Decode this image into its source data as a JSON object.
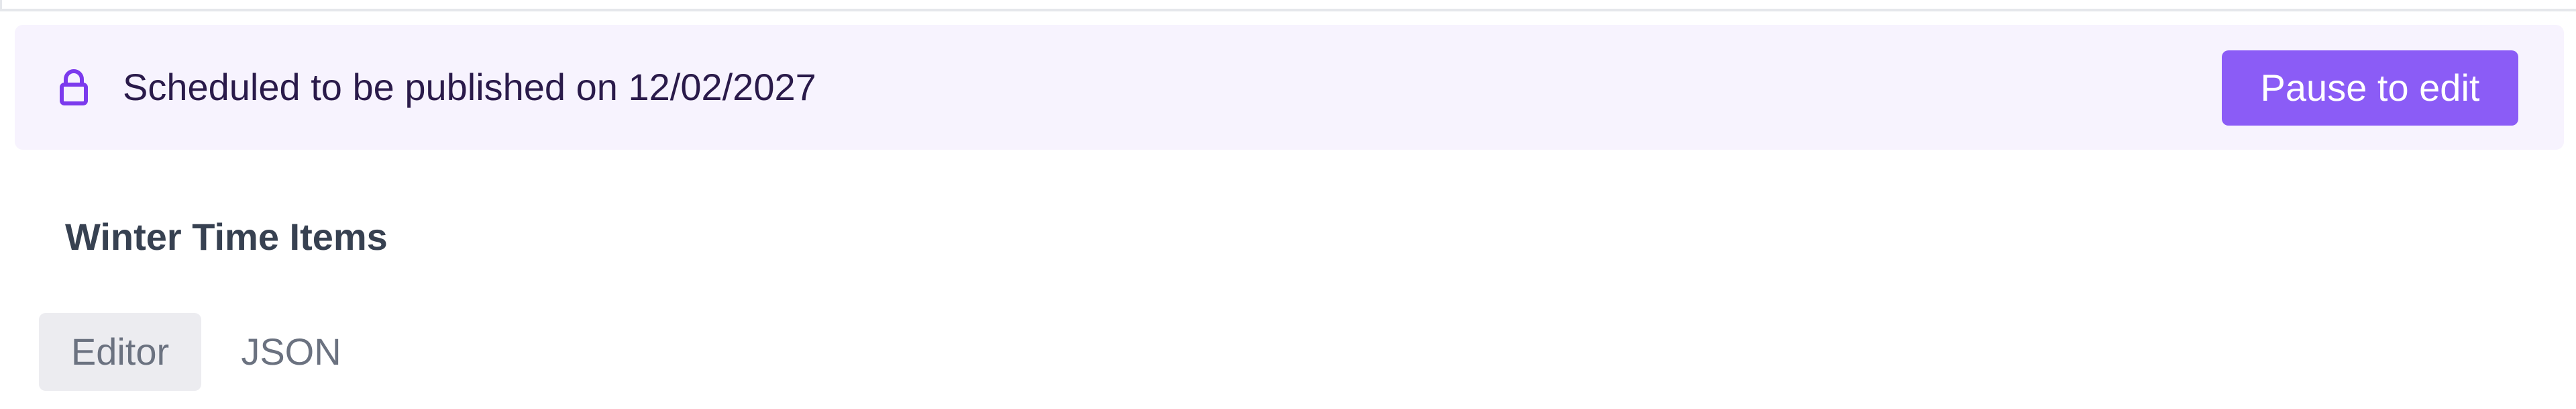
{
  "banner": {
    "icon": "lock-icon",
    "message": "Scheduled to be published on 12/02/2027",
    "action_label": "Pause to edit",
    "background_color": "#f7f3fe",
    "accent_color": "#8b5cf6"
  },
  "page": {
    "title": "Winter Time Items"
  },
  "tabs": [
    {
      "label": "Editor",
      "active": true
    },
    {
      "label": "JSON",
      "active": false
    }
  ]
}
